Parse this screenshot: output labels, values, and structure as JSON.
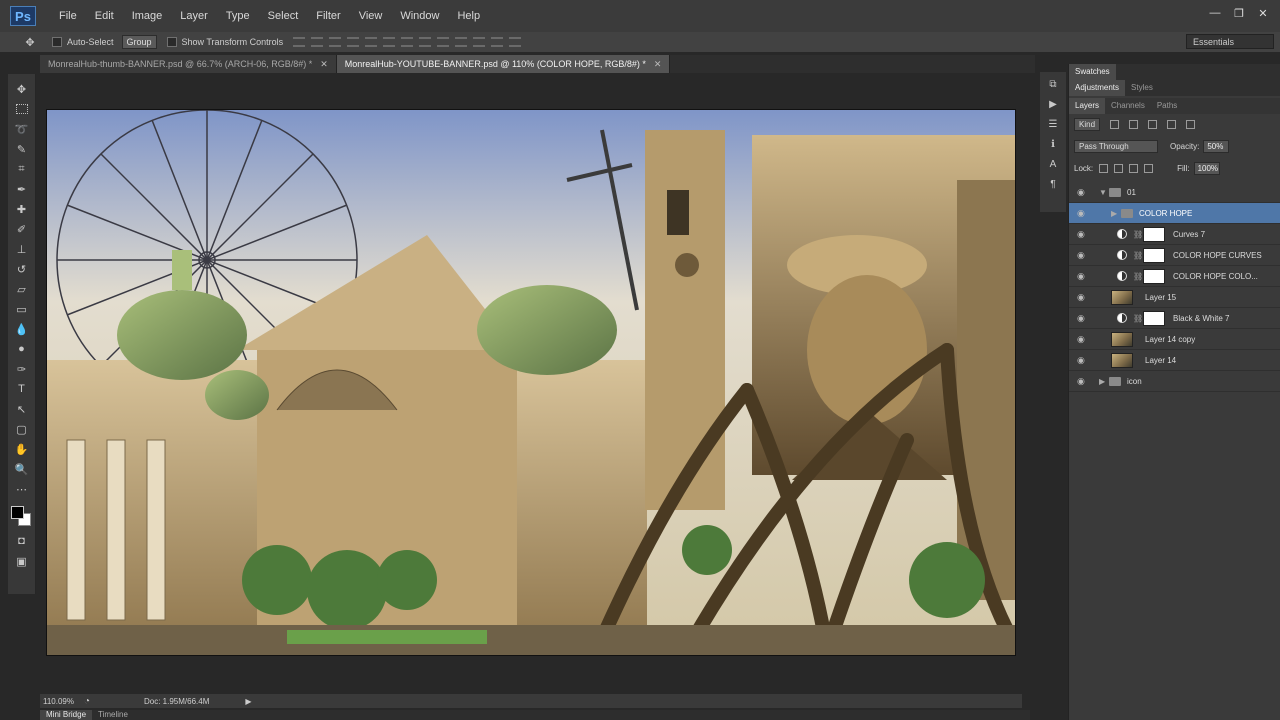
{
  "app": {
    "logo": "Ps"
  },
  "menu": [
    "File",
    "Edit",
    "Image",
    "Layer",
    "Type",
    "Select",
    "Filter",
    "View",
    "Window",
    "Help"
  ],
  "window_controls": {
    "minimize": "—",
    "restore": "❐",
    "close": "✕"
  },
  "options_bar": {
    "auto_select_label": "Auto-Select",
    "auto_select_target": "Group",
    "show_transform_label": "Show Transform Controls",
    "workspace": "Essentials"
  },
  "document_tabs": [
    {
      "title": "MonrealHub-thumb-BANNER.psd @ 66.7% (ARCH-06, RGB/8#) *",
      "active": false
    },
    {
      "title": "MonrealHub-YOUTUBE-BANNER.psd @ 110% (COLOR HOPE, RGB/8#) *",
      "active": true
    }
  ],
  "status_bar": {
    "zoom": "110.09%",
    "doc_size": "Doc: 1.95M/66.4M"
  },
  "bottom_tabs": [
    "Mini Bridge",
    "Timeline"
  ],
  "panels": {
    "top_tabs": [
      "Swatches"
    ],
    "adjust_tabs": [
      "Adjustments",
      "Styles"
    ],
    "layer_tabs": [
      "Layers",
      "Channels",
      "Paths"
    ],
    "filter_kind": "Kind",
    "blend_mode": "Pass Through",
    "opacity_label": "Opacity:",
    "opacity_value": "50%",
    "lock_label": "Lock:",
    "fill_label": "Fill:",
    "fill_value": "100%"
  },
  "layers": [
    {
      "name": "01",
      "type": "group",
      "indent": 0,
      "selected": false
    },
    {
      "name": "COLOR HOPE",
      "type": "group",
      "indent": 1,
      "selected": true
    },
    {
      "name": "Curves 7",
      "type": "adjustment",
      "indent": 2,
      "selected": false
    },
    {
      "name": "COLOR HOPE CURVES",
      "type": "adjustment",
      "indent": 2,
      "selected": false
    },
    {
      "name": "COLOR HOPE COLO...",
      "type": "adjustment",
      "indent": 2,
      "selected": false
    },
    {
      "name": "Layer 15",
      "type": "image",
      "indent": 1,
      "selected": false
    },
    {
      "name": "Black & White 7",
      "type": "adjustment",
      "indent": 1,
      "selected": false
    },
    {
      "name": "Layer 14 copy",
      "type": "image",
      "indent": 1,
      "selected": false
    },
    {
      "name": "Layer 14",
      "type": "image",
      "indent": 1,
      "selected": false
    },
    {
      "name": "icon",
      "type": "group",
      "indent": 0,
      "selected": false
    }
  ],
  "colors": {
    "selection": "#4f77a8",
    "app_bg": "#282828"
  }
}
